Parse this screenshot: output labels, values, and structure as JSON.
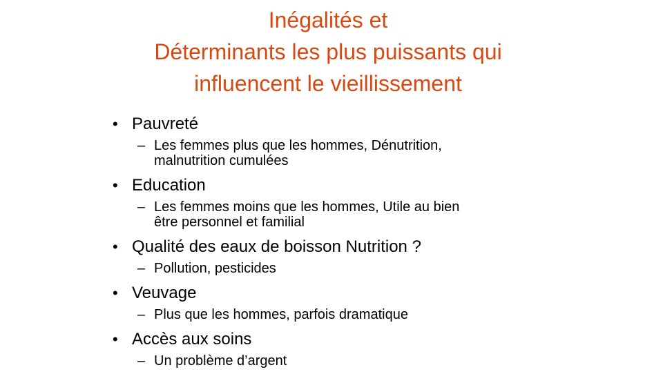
{
  "title": {
    "line1": "Inégalités et",
    "line2": "Déterminants les plus puissants qui",
    "line3": "influencent le vieillissement"
  },
  "bullets": [
    {
      "text": "Pauvreté",
      "sub": [
        "Les femmes plus que les hommes, Dénutrition,",
        "malnutrition cumulées"
      ]
    },
    {
      "text": "Education",
      "sub": [
        "Les femmes moins que les hommes, Utile au bien",
        "être personnel et familial"
      ]
    },
    {
      "text": "Qualité des eaux de boisson Nutrition ?",
      "sub": [
        "Pollution, pesticides"
      ]
    },
    {
      "text": "Veuvage",
      "sub": [
        "Plus que les hommes, parfois dramatique"
      ]
    },
    {
      "text": "Accès aux soins",
      "sub": [
        "Un problème d’argent"
      ]
    }
  ],
  "markers": {
    "bullet": "•",
    "dash": "–"
  },
  "colors": {
    "title": "#d9480f",
    "body": "#000000",
    "background": "#ffffff"
  }
}
